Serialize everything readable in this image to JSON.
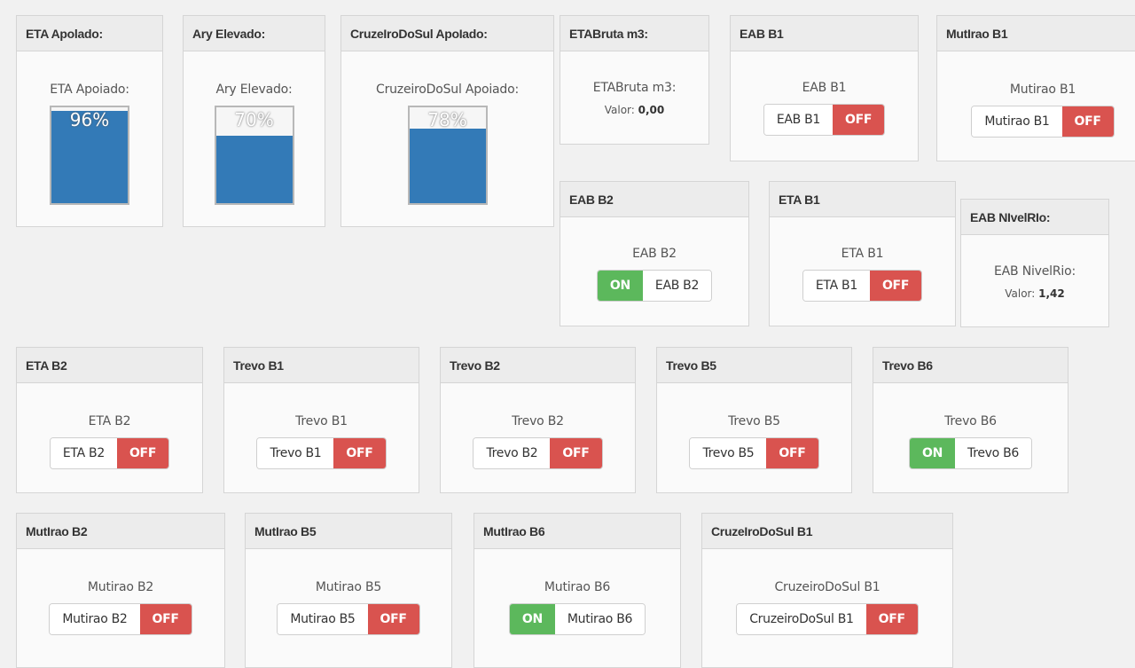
{
  "tanks": {
    "eta_apoiado": {
      "header": "ETA Apolado:",
      "label": "ETA Apoiado:",
      "level": 96,
      "level_text": "96%"
    },
    "ary_elevado": {
      "header": "Ary Elevado:",
      "label": "Ary Elevado:",
      "level": 70,
      "level_text": "70%"
    },
    "cruzeiro_apoiado": {
      "header": "CruzeIroDoSul ApoIado:",
      "label": "CruzeiroDoSul Apoiado:",
      "level": 78,
      "level_text": "78%"
    }
  },
  "values": {
    "etabruta": {
      "header": "ETABruta m3:",
      "label": "ETABruta m3:",
      "valor_label": "Valor:",
      "valor": "0,00"
    },
    "eab_nivelrio": {
      "header": "EAB NIvelRIo:",
      "label": "EAB NivelRio:",
      "valor_label": "Valor:",
      "valor": "1,42"
    }
  },
  "switches": {
    "eab_b1": {
      "header": "EAB B1",
      "label": "EAB B1",
      "name": "EAB B1",
      "state": "OFF"
    },
    "mutirao_b1": {
      "header": "MutIrao B1",
      "label": "Mutirao B1",
      "name": "Mutirao B1",
      "state": "OFF"
    },
    "eab_b2": {
      "header": "EAB B2",
      "label": "EAB B2",
      "name": "EAB B2",
      "state": "ON"
    },
    "eta_b1": {
      "header": "ETA B1",
      "label": "ETA B1",
      "name": "ETA B1",
      "state": "OFF"
    },
    "eta_b2": {
      "header": "ETA B2",
      "label": "ETA B2",
      "name": "ETA B2",
      "state": "OFF"
    },
    "trevo_b1": {
      "header": "Trevo B1",
      "label": "Trevo B1",
      "name": "Trevo B1",
      "state": "OFF"
    },
    "trevo_b2": {
      "header": "Trevo B2",
      "label": "Trevo B2",
      "name": "Trevo B2",
      "state": "OFF"
    },
    "trevo_b5": {
      "header": "Trevo B5",
      "label": "Trevo B5",
      "name": "Trevo B5",
      "state": "OFF"
    },
    "trevo_b6": {
      "header": "Trevo B6",
      "label": "Trevo B6",
      "name": "Trevo B6",
      "state": "ON"
    },
    "mutirao_b2": {
      "header": "MutIrao B2",
      "label": "Mutirao B2",
      "name": "Mutirao B2",
      "state": "OFF"
    },
    "mutirao_b5": {
      "header": "MutIrao B5",
      "label": "Mutirao B5",
      "name": "Mutirao B5",
      "state": "OFF"
    },
    "mutirao_b6": {
      "header": "MutIrao B6",
      "label": "Mutirao B6",
      "name": "Mutirao B6",
      "state": "ON"
    },
    "cruzeiro_b1": {
      "header": "CruzeIroDoSul B1",
      "label": "CruzeiroDoSul B1",
      "name": "CruzeiroDoSul B1",
      "state": "OFF"
    }
  },
  "colors": {
    "tank_fill": "#337ab7",
    "on": "#5cb85c",
    "off": "#d9534f"
  }
}
